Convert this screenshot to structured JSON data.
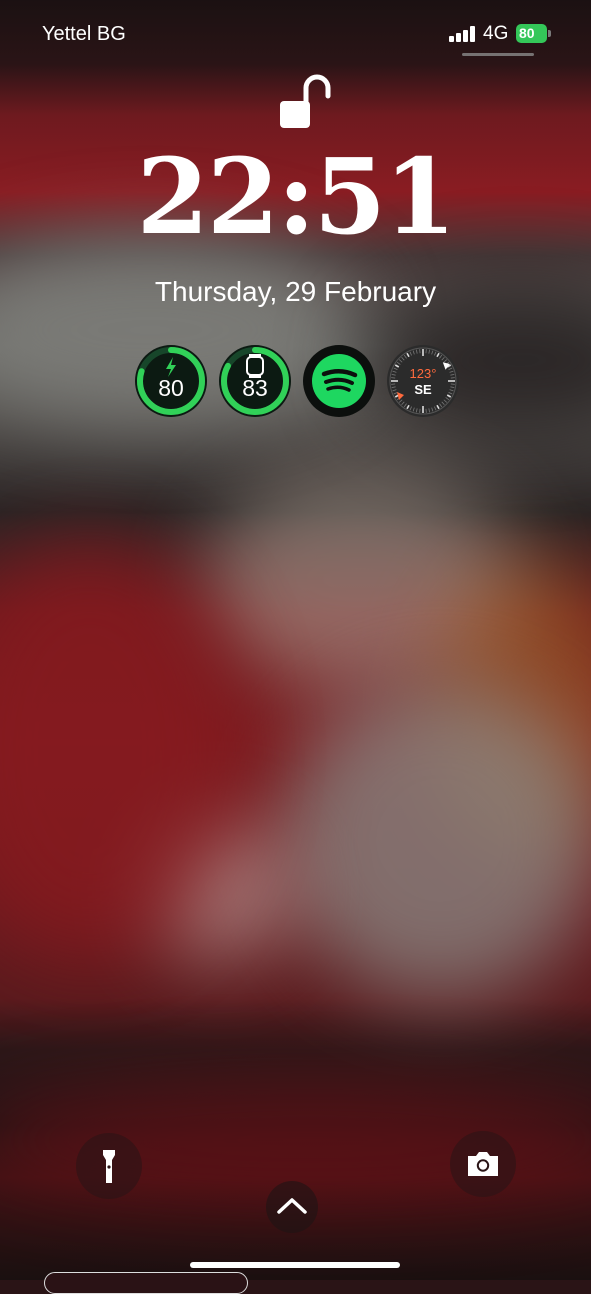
{
  "status_bar": {
    "carrier": "Yettel BG",
    "network": "4G",
    "battery_level": "80",
    "battery_color": "#34c759"
  },
  "lock_icon": "unlocked-padlock-icon",
  "clock": {
    "time": "22:51",
    "date": "Thursday, 29 February"
  },
  "widgets": {
    "phone_battery": {
      "value": "80",
      "fraction": 0.8,
      "icon": "bolt-icon",
      "color": "#31d158"
    },
    "watch_battery": {
      "value": "83",
      "fraction": 0.83,
      "icon": "watch-icon",
      "color": "#31d158"
    },
    "spotify": {
      "icon": "spotify-icon",
      "color": "#1ed760"
    },
    "compass": {
      "heading": "123°",
      "direction": "SE",
      "accent": "#ff6a3d"
    }
  },
  "bottom": {
    "flashlight": "flashlight-icon",
    "camera": "camera-icon",
    "swipe_up": "chevron-up-icon"
  }
}
